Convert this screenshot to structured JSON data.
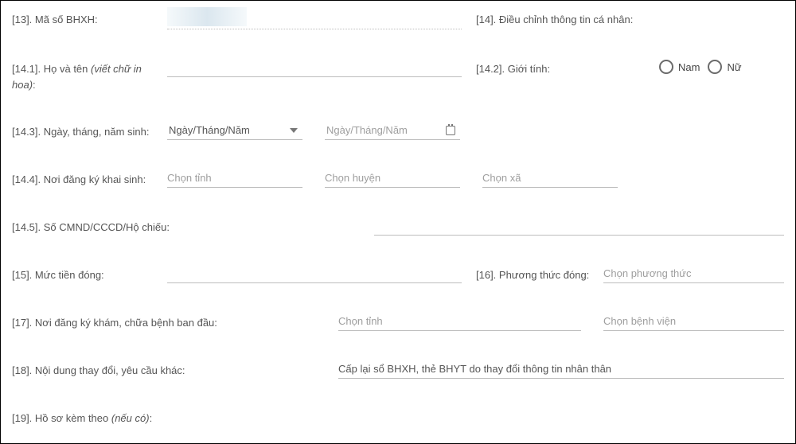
{
  "f13": {
    "label": "[13]. Mã số BHXH:"
  },
  "f14": {
    "label": "[14]. Điều chỉnh thông tin cá nhân:"
  },
  "f14_1": {
    "label_pre": "[14.1]. Họ và tên ",
    "label_em": "(viết chữ in hoa)",
    "label_post": ":"
  },
  "f14_2": {
    "label": "[14.2]. Giới tính:",
    "opt_male": "Nam",
    "opt_female": "Nữ"
  },
  "f14_3": {
    "label": "[14.3]. Ngày, tháng, năm sinh:",
    "select_text": "Ngày/Tháng/Năm",
    "date_placeholder": "Ngày/Tháng/Năm"
  },
  "f14_4": {
    "label": "[14.4]. Nơi đăng ký khai sinh:",
    "province_ph": "Chọn tỉnh",
    "district_ph": "Chọn huyện",
    "ward_ph": "Chọn xã"
  },
  "f14_5": {
    "label": "[14.5]. Số CMND/CCCD/Hộ chiếu:"
  },
  "f15": {
    "label": "[15]. Mức tiền đóng:"
  },
  "f16": {
    "label": "[16]. Phương thức đóng:",
    "placeholder": "Chọn phương thức"
  },
  "f17": {
    "label": "[17]. Nơi đăng ký khám, chữa bệnh ban đầu:",
    "province_ph": "Chọn tỉnh",
    "hospital_ph": "Chọn bệnh viện"
  },
  "f18": {
    "label": "[18]. Nội dung thay đổi, yêu cầu khác:",
    "value": "Cấp lại sổ BHXH, thẻ BHYT do thay đổi thông tin nhân thân"
  },
  "f19": {
    "label_pre": "[19]. Hồ sơ kèm theo ",
    "label_em": "(nếu có)",
    "label_post": ":"
  }
}
